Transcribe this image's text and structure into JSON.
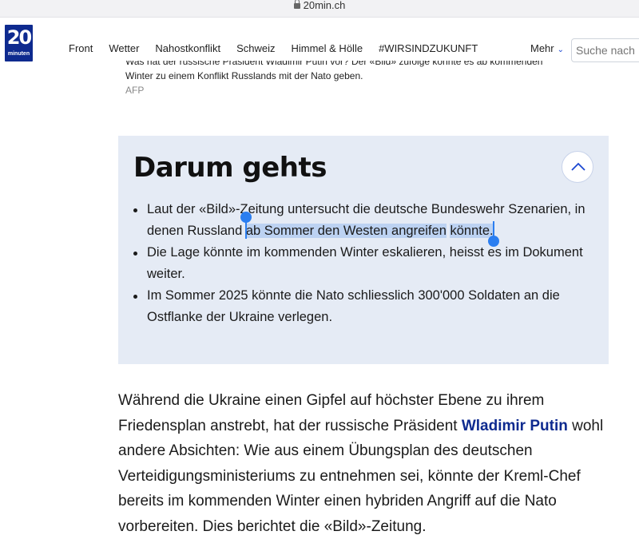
{
  "browser": {
    "url": "20min.ch"
  },
  "header": {
    "logo_number": "20",
    "logo_word": "minuten",
    "nav": [
      "Front",
      "Wetter",
      "Nahostkonflikt",
      "Schweiz",
      "Himmel & Hölle",
      "#WIRSINDZUKUNFT"
    ],
    "more_label": "Mehr",
    "search_placeholder": "Suche nach"
  },
  "caption": {
    "line1": "Was hat der russische Präsident Wladimir Putin vor? Der «Bild» zufolge könnte es ab kommenden",
    "line2": "Winter zu einem Konflikt Russlands mit der Nato geben.",
    "credit": "AFP"
  },
  "summary": {
    "title": "Darum gehts",
    "item1_pre": "Laut der «Bild»-Zeitung untersucht die deutsche Bundeswehr Szenarien, in denen Russland",
    "item1_sel_a": "ab Sommer den Westen angreifen",
    "item1_sel_b": "könnte.",
    "item2": "Die Lage könnte im kommenden Winter eskalieren, heisst es im Dokument weiter.",
    "item3": "Im Sommer 2025 könnte die Nato schliesslich 300'000 Soldaten an die Ostflanke der Ukraine verlegen."
  },
  "article": {
    "p1_pre": "Während die Ukraine einen Gipfel auf höchster Ebene zu ihrem Friedensplan anstrebt, hat der russische Präsident",
    "p1_name": "Wladimir Putin",
    "p1_post": "wohl andere Absichten: Wie aus einem Übungsplan des deutschen Verteidigungsministeriums zu entnehmen sei, könnte der Kreml-Chef bereits im kommenden Winter einen hybriden Angriff auf die Nato vorbereiten. Dies berichtet die «Bild»-Zeitung."
  },
  "colors": {
    "brand": "#0e2a8f",
    "summary_bg": "#e5ebf5",
    "selection": "#bcd2f2",
    "handle": "#2b7ef0"
  }
}
